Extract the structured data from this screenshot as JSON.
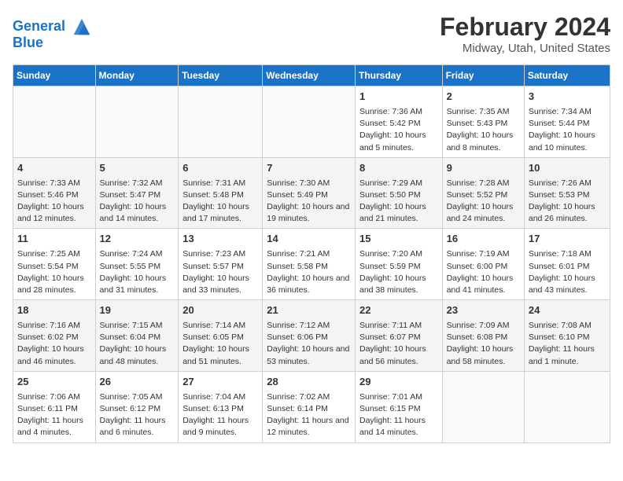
{
  "header": {
    "logo_line1": "General",
    "logo_line2": "Blue",
    "title": "February 2024",
    "subtitle": "Midway, Utah, United States"
  },
  "days_of_week": [
    "Sunday",
    "Monday",
    "Tuesday",
    "Wednesday",
    "Thursday",
    "Friday",
    "Saturday"
  ],
  "weeks": [
    [
      {
        "day": "",
        "empty": true
      },
      {
        "day": "",
        "empty": true
      },
      {
        "day": "",
        "empty": true
      },
      {
        "day": "",
        "empty": true
      },
      {
        "day": "1",
        "sunrise": "Sunrise: 7:36 AM",
        "sunset": "Sunset: 5:42 PM",
        "daylight": "Daylight: 10 hours and 5 minutes."
      },
      {
        "day": "2",
        "sunrise": "Sunrise: 7:35 AM",
        "sunset": "Sunset: 5:43 PM",
        "daylight": "Daylight: 10 hours and 8 minutes."
      },
      {
        "day": "3",
        "sunrise": "Sunrise: 7:34 AM",
        "sunset": "Sunset: 5:44 PM",
        "daylight": "Daylight: 10 hours and 10 minutes."
      }
    ],
    [
      {
        "day": "4",
        "sunrise": "Sunrise: 7:33 AM",
        "sunset": "Sunset: 5:46 PM",
        "daylight": "Daylight: 10 hours and 12 minutes."
      },
      {
        "day": "5",
        "sunrise": "Sunrise: 7:32 AM",
        "sunset": "Sunset: 5:47 PM",
        "daylight": "Daylight: 10 hours and 14 minutes."
      },
      {
        "day": "6",
        "sunrise": "Sunrise: 7:31 AM",
        "sunset": "Sunset: 5:48 PM",
        "daylight": "Daylight: 10 hours and 17 minutes."
      },
      {
        "day": "7",
        "sunrise": "Sunrise: 7:30 AM",
        "sunset": "Sunset: 5:49 PM",
        "daylight": "Daylight: 10 hours and 19 minutes."
      },
      {
        "day": "8",
        "sunrise": "Sunrise: 7:29 AM",
        "sunset": "Sunset: 5:50 PM",
        "daylight": "Daylight: 10 hours and 21 minutes."
      },
      {
        "day": "9",
        "sunrise": "Sunrise: 7:28 AM",
        "sunset": "Sunset: 5:52 PM",
        "daylight": "Daylight: 10 hours and 24 minutes."
      },
      {
        "day": "10",
        "sunrise": "Sunrise: 7:26 AM",
        "sunset": "Sunset: 5:53 PM",
        "daylight": "Daylight: 10 hours and 26 minutes."
      }
    ],
    [
      {
        "day": "11",
        "sunrise": "Sunrise: 7:25 AM",
        "sunset": "Sunset: 5:54 PM",
        "daylight": "Daylight: 10 hours and 28 minutes."
      },
      {
        "day": "12",
        "sunrise": "Sunrise: 7:24 AM",
        "sunset": "Sunset: 5:55 PM",
        "daylight": "Daylight: 10 hours and 31 minutes."
      },
      {
        "day": "13",
        "sunrise": "Sunrise: 7:23 AM",
        "sunset": "Sunset: 5:57 PM",
        "daylight": "Daylight: 10 hours and 33 minutes."
      },
      {
        "day": "14",
        "sunrise": "Sunrise: 7:21 AM",
        "sunset": "Sunset: 5:58 PM",
        "daylight": "Daylight: 10 hours and 36 minutes."
      },
      {
        "day": "15",
        "sunrise": "Sunrise: 7:20 AM",
        "sunset": "Sunset: 5:59 PM",
        "daylight": "Daylight: 10 hours and 38 minutes."
      },
      {
        "day": "16",
        "sunrise": "Sunrise: 7:19 AM",
        "sunset": "Sunset: 6:00 PM",
        "daylight": "Daylight: 10 hours and 41 minutes."
      },
      {
        "day": "17",
        "sunrise": "Sunrise: 7:18 AM",
        "sunset": "Sunset: 6:01 PM",
        "daylight": "Daylight: 10 hours and 43 minutes."
      }
    ],
    [
      {
        "day": "18",
        "sunrise": "Sunrise: 7:16 AM",
        "sunset": "Sunset: 6:02 PM",
        "daylight": "Daylight: 10 hours and 46 minutes."
      },
      {
        "day": "19",
        "sunrise": "Sunrise: 7:15 AM",
        "sunset": "Sunset: 6:04 PM",
        "daylight": "Daylight: 10 hours and 48 minutes."
      },
      {
        "day": "20",
        "sunrise": "Sunrise: 7:14 AM",
        "sunset": "Sunset: 6:05 PM",
        "daylight": "Daylight: 10 hours and 51 minutes."
      },
      {
        "day": "21",
        "sunrise": "Sunrise: 7:12 AM",
        "sunset": "Sunset: 6:06 PM",
        "daylight": "Daylight: 10 hours and 53 minutes."
      },
      {
        "day": "22",
        "sunrise": "Sunrise: 7:11 AM",
        "sunset": "Sunset: 6:07 PM",
        "daylight": "Daylight: 10 hours and 56 minutes."
      },
      {
        "day": "23",
        "sunrise": "Sunrise: 7:09 AM",
        "sunset": "Sunset: 6:08 PM",
        "daylight": "Daylight: 10 hours and 58 minutes."
      },
      {
        "day": "24",
        "sunrise": "Sunrise: 7:08 AM",
        "sunset": "Sunset: 6:10 PM",
        "daylight": "Daylight: 11 hours and 1 minute."
      }
    ],
    [
      {
        "day": "25",
        "sunrise": "Sunrise: 7:06 AM",
        "sunset": "Sunset: 6:11 PM",
        "daylight": "Daylight: 11 hours and 4 minutes."
      },
      {
        "day": "26",
        "sunrise": "Sunrise: 7:05 AM",
        "sunset": "Sunset: 6:12 PM",
        "daylight": "Daylight: 11 hours and 6 minutes."
      },
      {
        "day": "27",
        "sunrise": "Sunrise: 7:04 AM",
        "sunset": "Sunset: 6:13 PM",
        "daylight": "Daylight: 11 hours and 9 minutes."
      },
      {
        "day": "28",
        "sunrise": "Sunrise: 7:02 AM",
        "sunset": "Sunset: 6:14 PM",
        "daylight": "Daylight: 11 hours and 12 minutes."
      },
      {
        "day": "29",
        "sunrise": "Sunrise: 7:01 AM",
        "sunset": "Sunset: 6:15 PM",
        "daylight": "Daylight: 11 hours and 14 minutes."
      },
      {
        "day": "",
        "empty": true
      },
      {
        "day": "",
        "empty": true
      }
    ]
  ]
}
